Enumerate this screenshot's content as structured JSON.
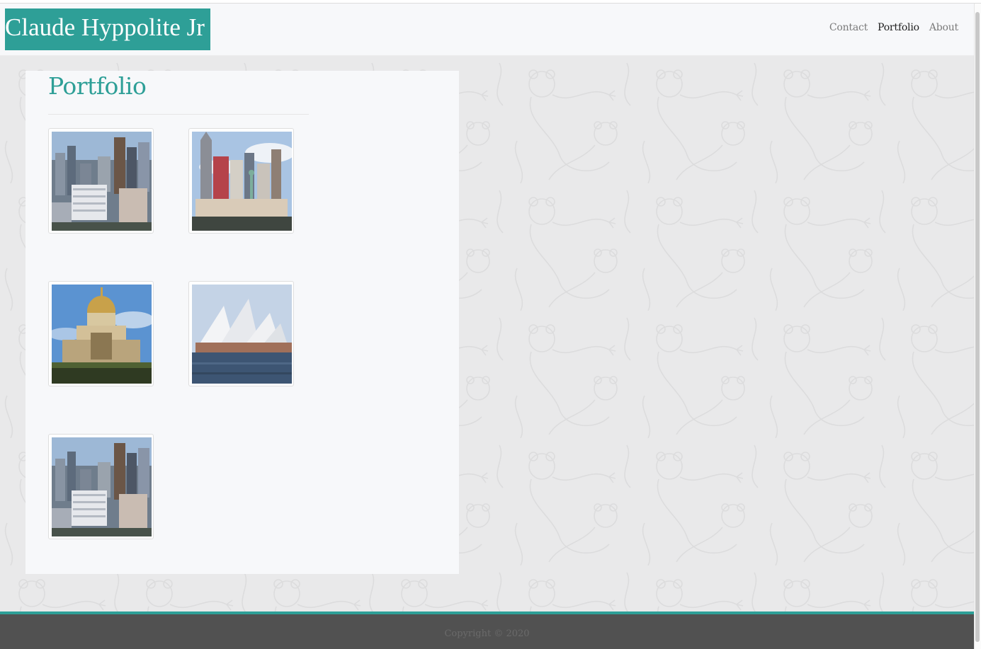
{
  "header": {
    "brand": "Claude Hyppolite Jr",
    "nav": [
      {
        "label": "Contact",
        "active": false
      },
      {
        "label": "Portfolio",
        "active": true
      },
      {
        "label": "About",
        "active": false
      }
    ]
  },
  "main": {
    "title": "Portfolio",
    "items": [
      {
        "name": "city-skyline-photo"
      },
      {
        "name": "new-york-new-york-casino-photo"
      },
      {
        "name": "les-invalides-dome-photo"
      },
      {
        "name": "sydney-opera-house-photo"
      },
      {
        "name": "city-skyline-photo"
      }
    ]
  },
  "footer": {
    "copyright": "Copyright © 2020"
  },
  "colors": {
    "accent": "#2e9f97",
    "footer": "#515151",
    "background": "#e9e9ea",
    "panel": "#f7f8fa"
  }
}
